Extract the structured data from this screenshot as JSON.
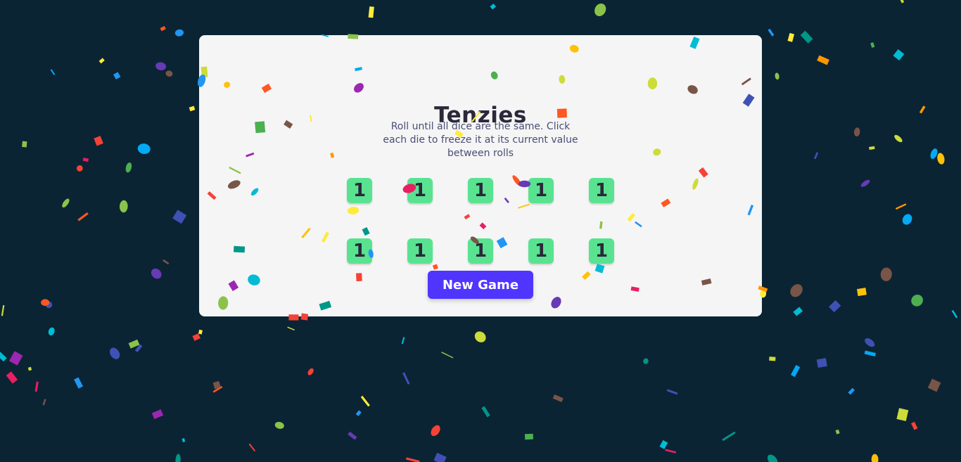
{
  "game": {
    "title": "Tenzies",
    "instructions": "Roll until all dice are the same. Click each die to freeze it at its current value between rolls",
    "dice": [
      {
        "value": "1",
        "held": true
      },
      {
        "value": "1",
        "held": true
      },
      {
        "value": "1",
        "held": true
      },
      {
        "value": "1",
        "held": true
      },
      {
        "value": "1",
        "held": true
      },
      {
        "value": "1",
        "held": true
      },
      {
        "value": "1",
        "held": true
      },
      {
        "value": "1",
        "held": true
      },
      {
        "value": "1",
        "held": true
      },
      {
        "value": "1",
        "held": true
      }
    ],
    "button_label": "New Game",
    "won": true
  },
  "colors": {
    "background": "#0b2434",
    "card": "#f5f5f5",
    "title": "#2b283a",
    "instructions": "#4a4e74",
    "die_held": "#59e391",
    "die_free": "#ffffff",
    "button": "#5035ff",
    "confetti": [
      "#f44336",
      "#e91e63",
      "#9c27b0",
      "#673ab7",
      "#3f51b5",
      "#2196f3",
      "#03a9f4",
      "#00bcd4",
      "#009688",
      "#4caf50",
      "#8bc34a",
      "#cddc39",
      "#ffeb3b",
      "#ffc107",
      "#ff9800",
      "#ff5722",
      "#795548"
    ]
  }
}
